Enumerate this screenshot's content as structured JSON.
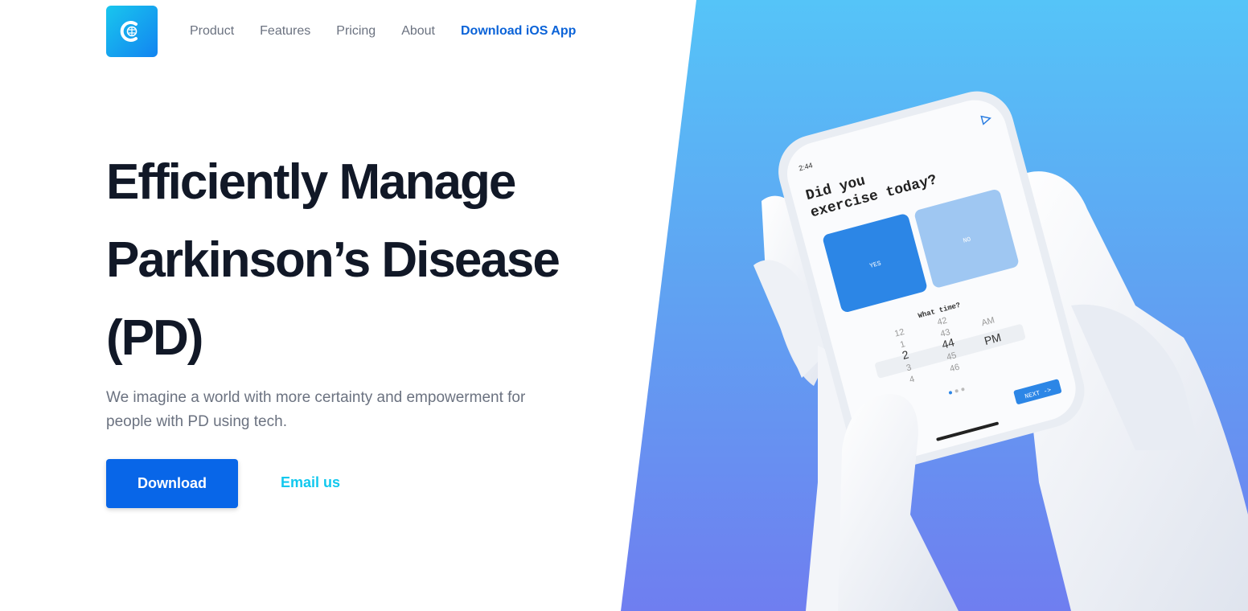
{
  "nav": {
    "logo_icon": "brain-icon",
    "items": [
      {
        "label": "Product"
      },
      {
        "label": "Features"
      },
      {
        "label": "Pricing"
      },
      {
        "label": "About"
      }
    ],
    "ios_link": "Download iOS App"
  },
  "hero": {
    "headline_line1": "Efficiently Manage",
    "headline_line2": "Parkinson’s Disease",
    "headline_line3": "(PD)",
    "lead": "We imagine a world with more certainty and empowerment for people with PD using tech.",
    "primary_button": "Download",
    "secondary_link": "Email us"
  },
  "phone": {
    "status_time": "2:44",
    "question": "Did you exercise today?",
    "question_line1": "Did you",
    "question_line2": "exercise today?",
    "yes_label": "YES",
    "no_label": "NO",
    "time_prompt": "What time?",
    "picker": {
      "hours": [
        "12",
        "1",
        "2",
        "3",
        "4"
      ],
      "minutes": [
        "42",
        "43",
        "44",
        "45",
        "46"
      ],
      "period": [
        "AM",
        "PM"
      ]
    },
    "next_button": "NEXT ->"
  },
  "colors": {
    "primary": "#0866e8",
    "accent": "#12c8ee",
    "ios_link": "#0b63d8",
    "headline": "#111827"
  }
}
